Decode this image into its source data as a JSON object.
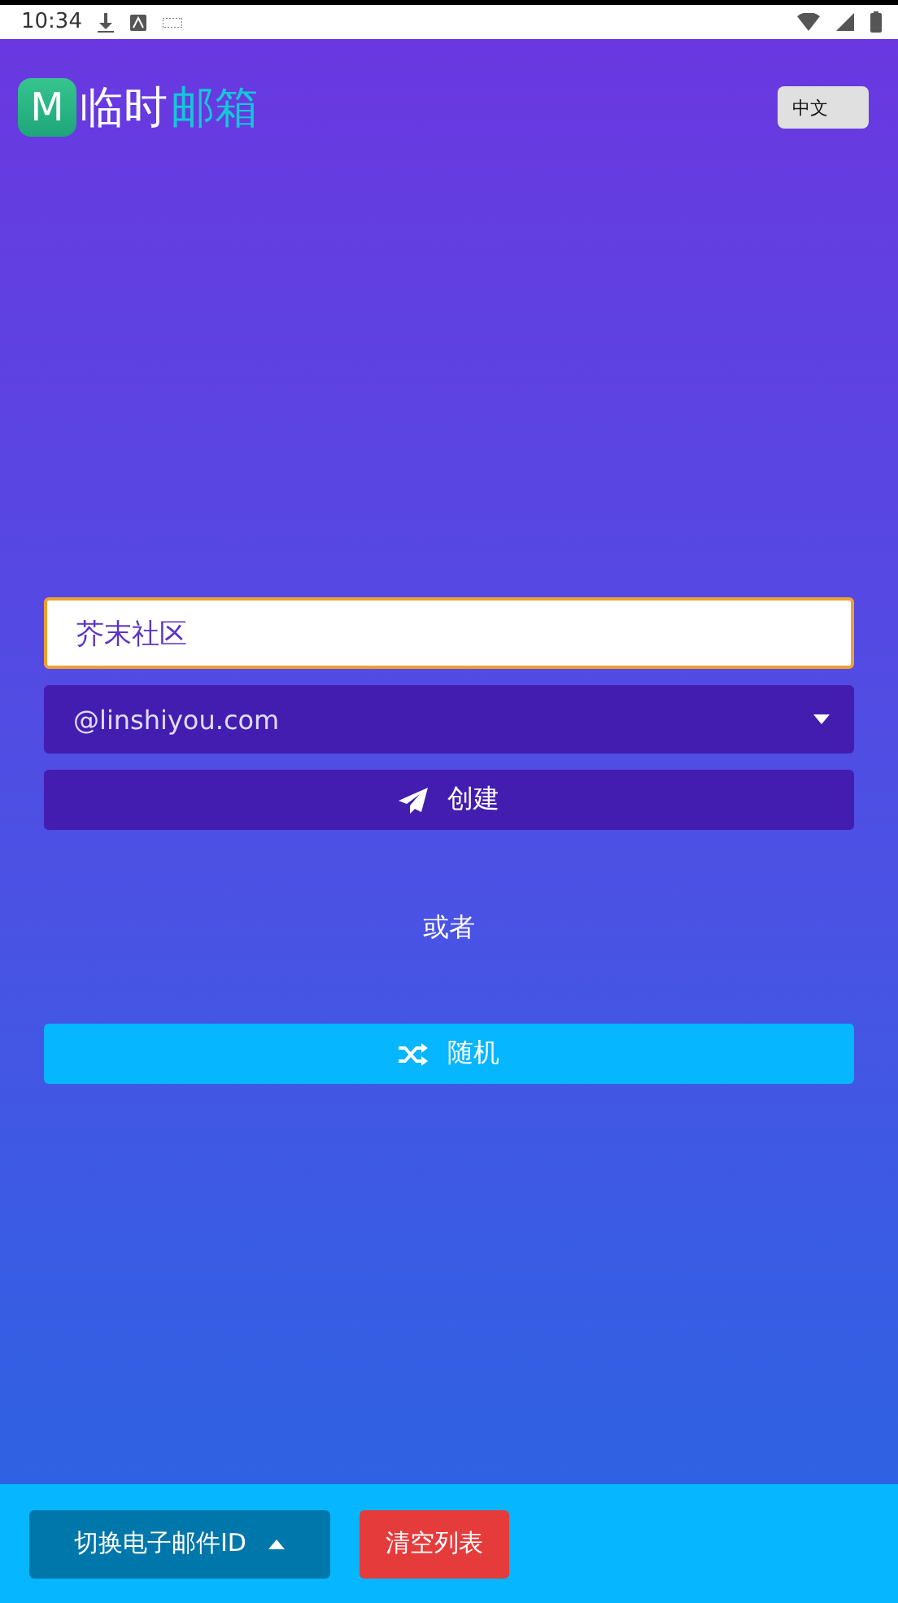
{
  "status_bar": {
    "time": "10:34"
  },
  "header": {
    "logo_mark": "M",
    "logo_parts": [
      {
        "text": "临时",
        "kind": "plain"
      },
      {
        "text": "邮箱",
        "kind": "accent"
      }
    ],
    "language_button": "中文"
  },
  "form": {
    "name_field": {
      "value": "芥末社区",
      "focused": true
    },
    "domain_select": {
      "value": "@linshiyou.com"
    },
    "create_button": "创建",
    "separator": "或者",
    "random_button": "随机"
  },
  "bottom_bar": {
    "switch_button": "切换电子邮件ID",
    "clear_button": "清空列表"
  }
}
